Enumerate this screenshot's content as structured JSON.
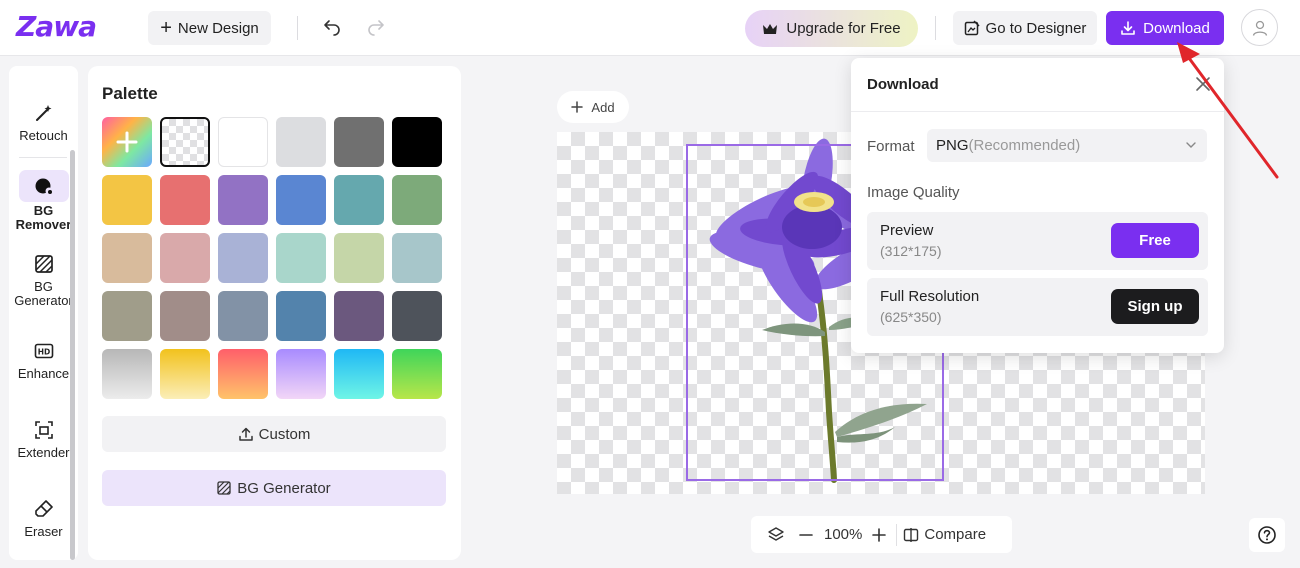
{
  "header": {
    "logo": "Zawa",
    "new_design": "New Design",
    "upgrade": "Upgrade for Free",
    "go_designer": "Go to Designer",
    "download": "Download"
  },
  "tools": [
    {
      "label": "Retouch",
      "icon": "magic-wand-icon"
    },
    {
      "label": "BG Remover",
      "icon": "bg-remover-icon",
      "active": true
    },
    {
      "label": "BG Generator",
      "icon": "bg-generator-icon"
    },
    {
      "label": "Enhance",
      "icon": "hd-icon"
    },
    {
      "label": "Extender",
      "icon": "extender-icon"
    },
    {
      "label": "Eraser",
      "icon": "eraser-icon"
    }
  ],
  "palette": {
    "title": "Palette",
    "custom_label": "Custom",
    "bg_generator_label": "BG Generator",
    "swatches": [
      [
        "rainbow-add",
        "transparent",
        "#ffffff",
        "#dcdde0",
        "#707070",
        "#000000"
      ],
      [
        "#f3c544",
        "#e77070",
        "#9272c4",
        "#5a86d2",
        "#65a8ae",
        "#7daa7a"
      ],
      [
        "#d8bb9c",
        "#d9a9aa",
        "#a9b2d6",
        "#a9d6cb",
        "#c5d6a8",
        "#a7c6ca"
      ],
      [
        "#a09d8a",
        "#a18d89",
        "#8292a6",
        "#5383ac",
        "#6b587e",
        "#4e535b"
      ],
      [
        "gradient-gray",
        "gradient-yellow",
        "gradient-red",
        "gradient-violet",
        "gradient-cyan",
        "gradient-green"
      ]
    ]
  },
  "canvas": {
    "add_label": "Add"
  },
  "zoom": {
    "level": "100%",
    "compare": "Compare"
  },
  "download_panel": {
    "title": "Download",
    "format_label": "Format",
    "format_value": "PNG",
    "format_note": "(Recommended)",
    "quality_label": "Image Quality",
    "options": [
      {
        "name": "Preview",
        "resolution": "(312*175)",
        "action": "Free"
      },
      {
        "name": "Full Resolution",
        "resolution": "(625*350)",
        "action": "Sign up"
      }
    ]
  },
  "colors": {
    "accent": "#7a2ff0",
    "annotation_arrow": "#e0262b"
  }
}
